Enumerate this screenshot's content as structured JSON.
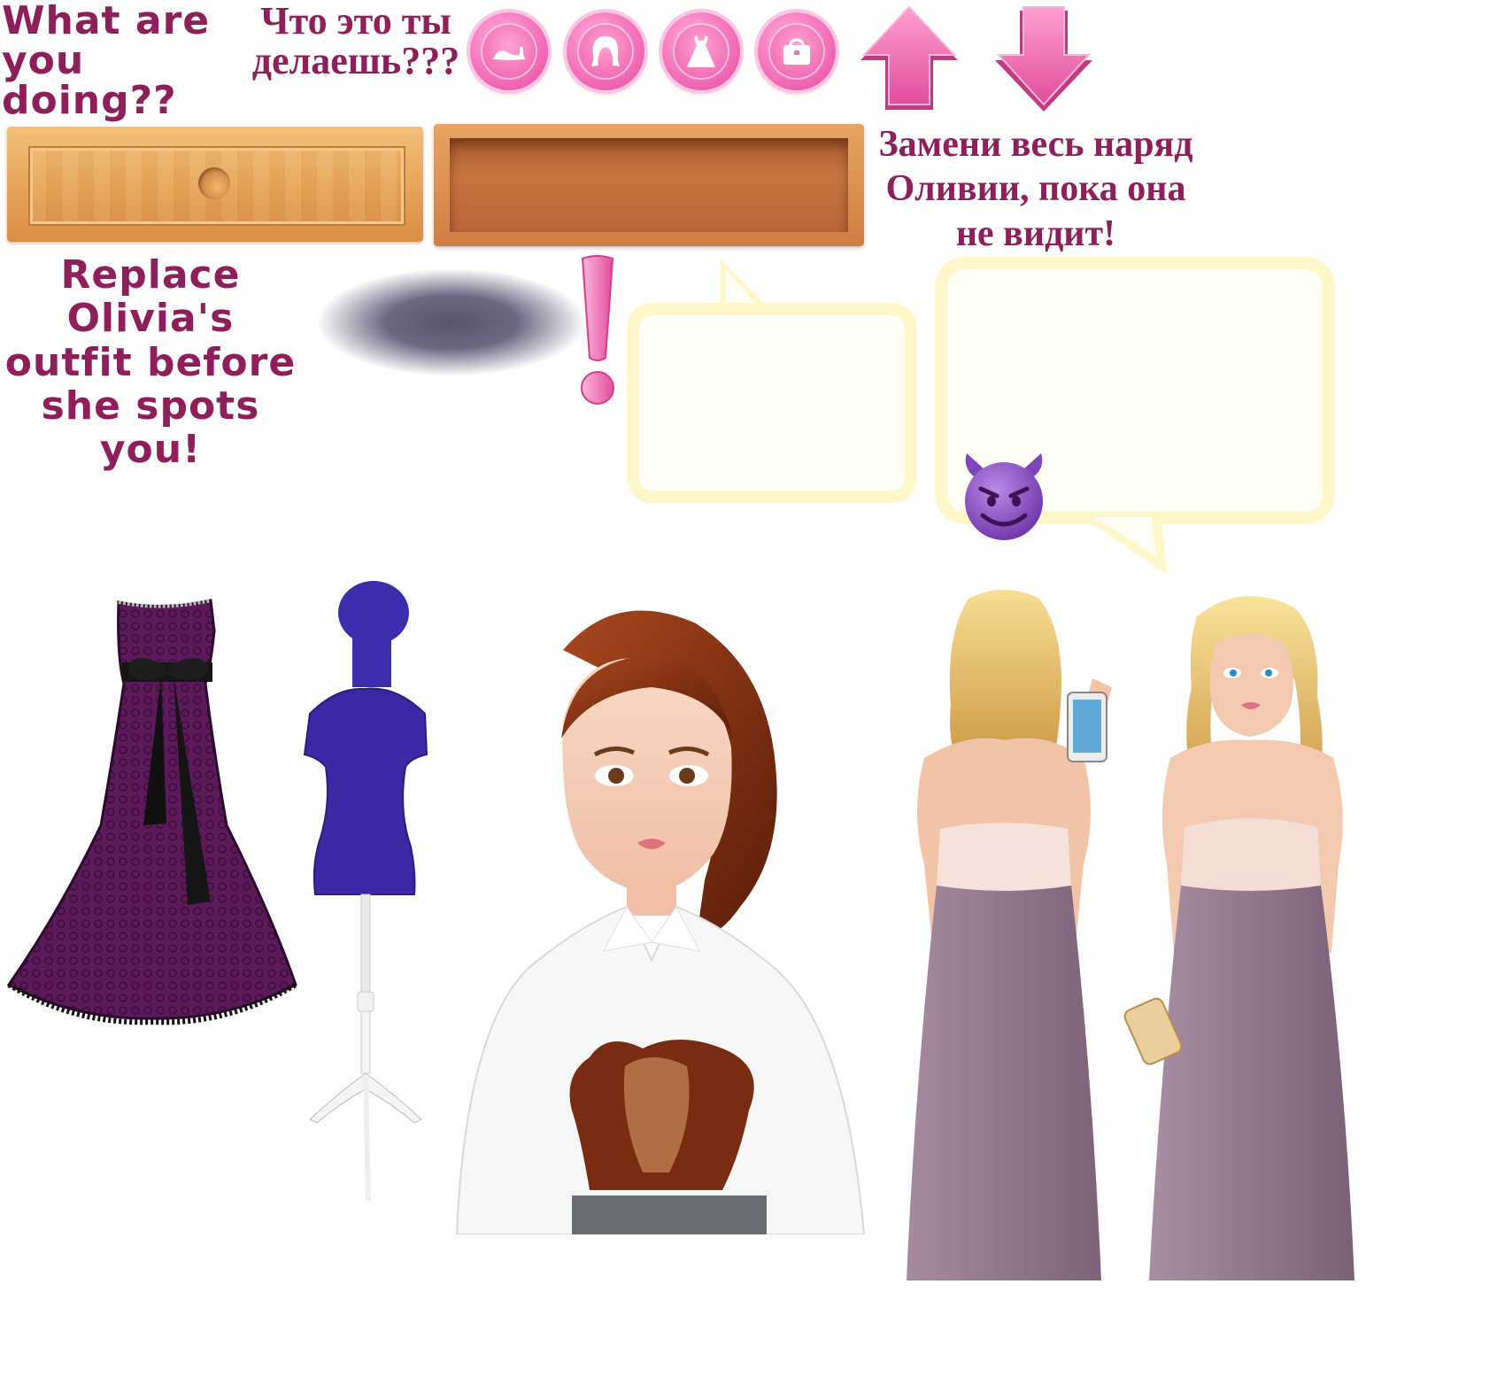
{
  "captions": {
    "what_en": "What are you doing??",
    "what_ru": "Что это ты делаешь???",
    "replace_en": "Replace Olivia's outfit before she spots you!",
    "replace_ru": "Замени весь наряд Оливии, пока она не видит!"
  },
  "category_buttons": [
    {
      "label": "shoes",
      "icon": "shoe-icon"
    },
    {
      "label": "hair",
      "icon": "hair-icon"
    },
    {
      "label": "dress",
      "icon": "dress-icon"
    },
    {
      "label": "bag",
      "icon": "bag-icon"
    }
  ],
  "arrows": {
    "up": "arrow-up-icon",
    "down": "arrow-down-icon"
  },
  "alert": {
    "symbol": "!"
  },
  "colors": {
    "caption": "#8e1f5a",
    "pink": "#f06fb8",
    "wood_light": "#e9a85a",
    "wood_dark": "#c8713e",
    "bubble_border": "#fff7c9",
    "gown": "#5a1a57",
    "mannequin": "#3c2aa6",
    "devil": "#8a4fc4",
    "skirt": "#8a6e84"
  },
  "assets": {
    "gown": "lace-mermaid-gown",
    "mannequin": "dress-form",
    "girl": "stained-blouse-girl",
    "olivia_back": "olivia-back-view",
    "olivia_front": "olivia-front-view"
  }
}
